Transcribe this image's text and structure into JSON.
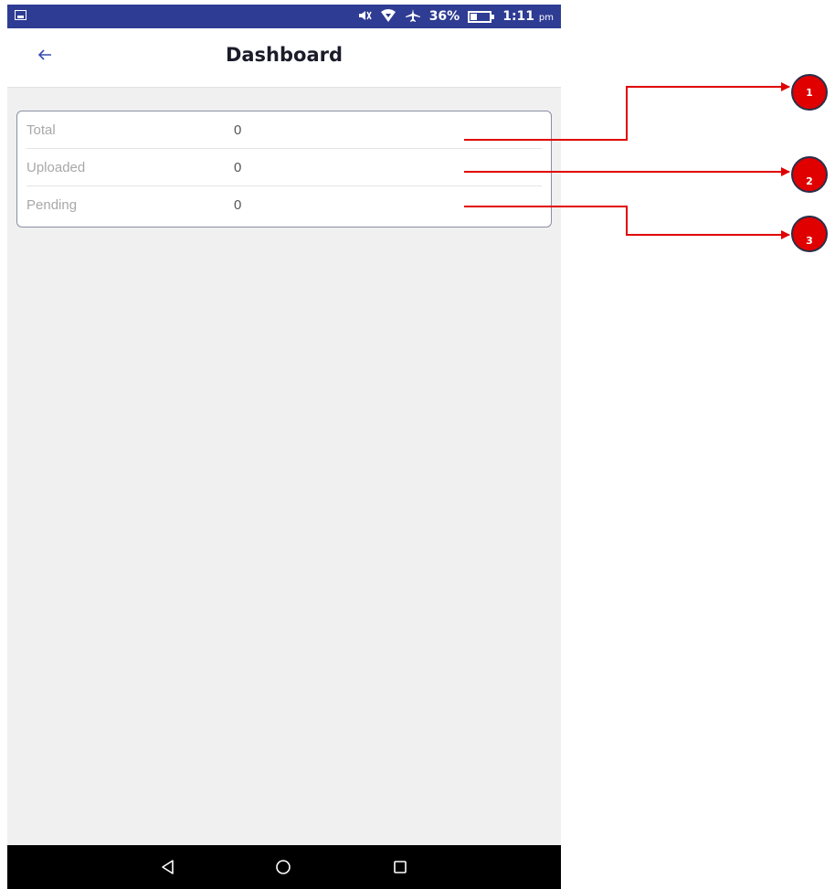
{
  "status_bar": {
    "battery_percent": "36%",
    "battery_level": 0.36,
    "time": "1:11",
    "time_suffix": "pm",
    "icons": [
      "gallery-icon",
      "mute-icon",
      "wifi-icon",
      "airplane-icon",
      "battery-icon"
    ]
  },
  "header": {
    "title": "Dashboard",
    "back_icon": "arrow-left-icon"
  },
  "stats": [
    {
      "label": "Total",
      "value": "0"
    },
    {
      "label": "Uploaded",
      "value": "0"
    },
    {
      "label": "Pending",
      "value": "0"
    }
  ],
  "annotations": {
    "badges": [
      "1",
      "2",
      "3"
    ],
    "color": "#e00000"
  },
  "nav_bar": {
    "buttons": [
      "back-triangle-icon",
      "home-circle-icon",
      "recent-square-icon"
    ]
  },
  "colors": {
    "status_bar": "#2e3c93",
    "accent": "#3a4bb0",
    "background": "#f0f0f0"
  }
}
